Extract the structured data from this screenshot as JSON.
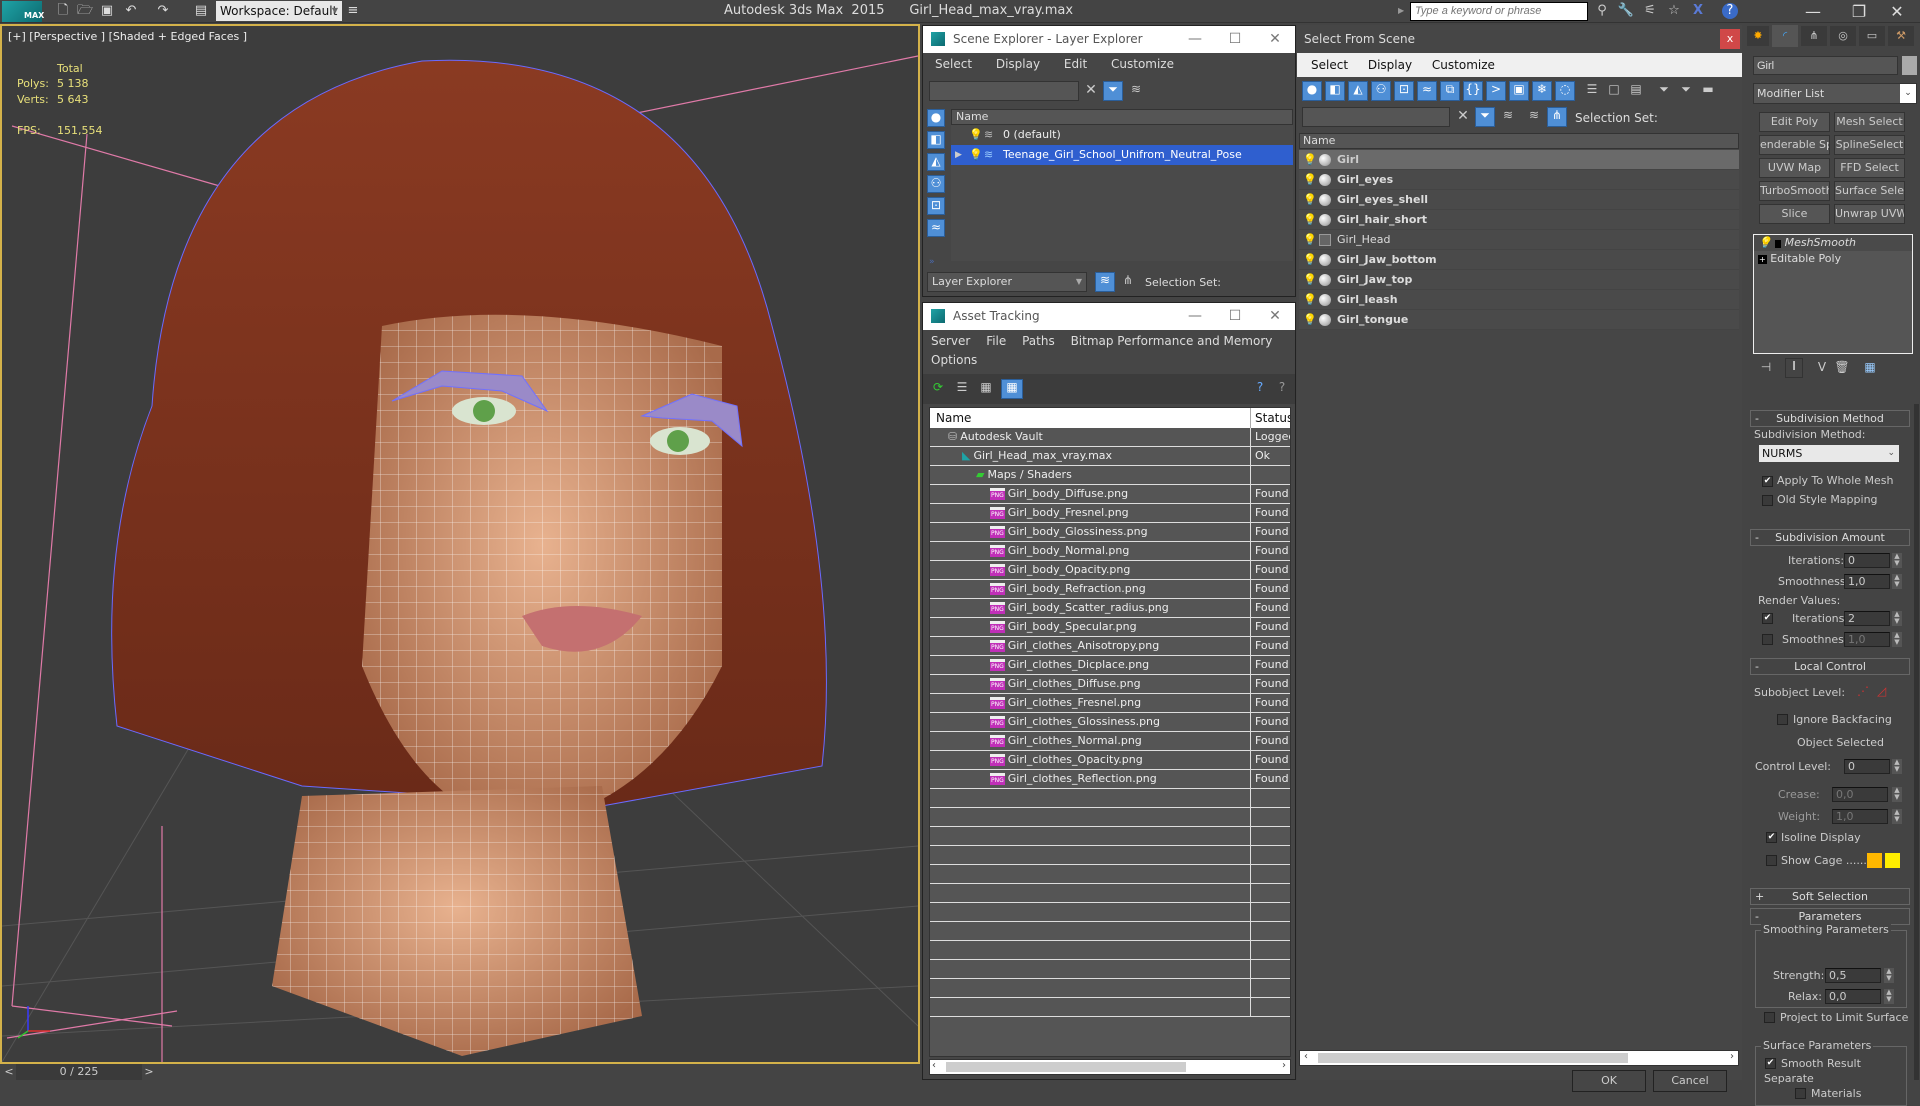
{
  "app": {
    "title": "Autodesk 3ds Max  2015      Girl_Head_max_vray.max",
    "logo_label": "MAX",
    "workspace": "Workspace: Default",
    "search_placeholder": "Type a keyword or phrase"
  },
  "viewport": {
    "label": "[+] [Perspective ] [Shaded + Edged Faces ]",
    "stats": {
      "total_label": "Total",
      "polys_label": "Polys:",
      "polys_value": "5 138",
      "verts_label": "Verts:",
      "verts_value": "5 643",
      "fps_label": "FPS:",
      "fps_value": "151,554"
    },
    "time_slider": "0 / 225",
    "prev_label": "<",
    "next_label": ">"
  },
  "scene_explorer": {
    "title": "Scene Explorer - Layer Explorer",
    "menu": [
      "Select",
      "Display",
      "Edit",
      "Customize"
    ],
    "column_name": "Name",
    "layers": [
      {
        "name": "0 (default)",
        "selected": false
      },
      {
        "name": "Teenage_Girl_School_Unifrom_Neutral_Pose",
        "selected": true
      }
    ],
    "mode": "Layer Explorer",
    "selection_set_label": "Selection Set:"
  },
  "asset_tracking": {
    "title": "Asset Tracking",
    "menu": [
      "Server",
      "File",
      "Paths",
      "Bitmap Performance and Memory",
      "Options"
    ],
    "columns": [
      "Name",
      "Status"
    ],
    "rows": [
      {
        "name": "Autodesk Vault",
        "status": "Logged",
        "level": 1,
        "icon": "vault-icon"
      },
      {
        "name": "Girl_Head_max_vray.max",
        "status": "Ok",
        "level": 2,
        "icon": "max-file-icon"
      },
      {
        "name": "Maps / Shaders",
        "status": "",
        "level": 3,
        "icon": "maps-icon"
      },
      {
        "name": "Girl_body_Diffuse.png",
        "status": "Found",
        "level": 4,
        "icon": "png-icon"
      },
      {
        "name": "Girl_body_Fresnel.png",
        "status": "Found",
        "level": 4,
        "icon": "png-icon"
      },
      {
        "name": "Girl_body_Glossiness.png",
        "status": "Found",
        "level": 4,
        "icon": "png-icon"
      },
      {
        "name": "Girl_body_Normal.png",
        "status": "Found",
        "level": 4,
        "icon": "png-icon"
      },
      {
        "name": "Girl_body_Opacity.png",
        "status": "Found",
        "level": 4,
        "icon": "png-icon"
      },
      {
        "name": "Girl_body_Refraction.png",
        "status": "Found",
        "level": 4,
        "icon": "png-icon"
      },
      {
        "name": "Girl_body_Scatter_radius.png",
        "status": "Found",
        "level": 4,
        "icon": "png-icon"
      },
      {
        "name": "Girl_body_Specular.png",
        "status": "Found",
        "level": 4,
        "icon": "png-icon"
      },
      {
        "name": "Girl_clothes_Anisotropy.png",
        "status": "Found",
        "level": 4,
        "icon": "png-icon"
      },
      {
        "name": "Girl_clothes_Dicplace.png",
        "status": "Found",
        "level": 4,
        "icon": "png-icon"
      },
      {
        "name": "Girl_clothes_Diffuse.png",
        "status": "Found",
        "level": 4,
        "icon": "png-icon"
      },
      {
        "name": "Girl_clothes_Fresnel.png",
        "status": "Found",
        "level": 4,
        "icon": "png-icon"
      },
      {
        "name": "Girl_clothes_Glossiness.png",
        "status": "Found",
        "level": 4,
        "icon": "png-icon"
      },
      {
        "name": "Girl_clothes_Normal.png",
        "status": "Found",
        "level": 4,
        "icon": "png-icon"
      },
      {
        "name": "Girl_clothes_Opacity.png",
        "status": "Found",
        "level": 4,
        "icon": "png-icon"
      },
      {
        "name": "Girl_clothes_Reflection.png",
        "status": "Found",
        "level": 4,
        "icon": "png-icon"
      }
    ],
    "png_badge": "PNG"
  },
  "select_from_scene": {
    "title": "Select From Scene",
    "close_label": "x",
    "menu": [
      "Select",
      "Display",
      "Customize"
    ],
    "selection_set_label": "Selection Set:",
    "column_name": "Name",
    "objects": [
      {
        "name": "Girl",
        "selected": true,
        "bold": true
      },
      {
        "name": "Girl_eyes",
        "selected": false,
        "bold": true
      },
      {
        "name": "Girl_eyes_shell",
        "selected": false,
        "bold": true
      },
      {
        "name": "Girl_hair_short",
        "selected": false,
        "bold": true
      },
      {
        "name": "Girl_Head",
        "selected": false,
        "bold": false
      },
      {
        "name": "Girl_Jaw_bottom",
        "selected": false,
        "bold": true
      },
      {
        "name": "Girl_Jaw_top",
        "selected": false,
        "bold": true
      },
      {
        "name": "Girl_leash",
        "selected": false,
        "bold": true
      },
      {
        "name": "Girl_tongue",
        "selected": false,
        "bold": true
      }
    ],
    "ok_label": "OK",
    "cancel_label": "Cancel"
  },
  "command_panel": {
    "object_name": "Girl",
    "modifier_list": "Modifier List",
    "modifier_buttons": [
      "Edit Poly",
      "Mesh Select",
      "enderable Splin",
      "SplineSelect",
      "UVW Map",
      "FFD Select",
      "TurboSmooth",
      "Surface Select",
      "Slice",
      "Unwrap UVW"
    ],
    "stack": [
      "MeshSmooth",
      "Editable Poly"
    ],
    "subdivision_method": {
      "header": "Subdivision Method",
      "label": "Subdivision Method:",
      "value": "NURMS",
      "apply_whole_mesh": {
        "label": "Apply To Whole Mesh",
        "checked": true
      },
      "old_style_mapping": {
        "label": "Old Style Mapping",
        "checked": false
      }
    },
    "subdivision_amount": {
      "header": "Subdivision Amount",
      "iterations_label": "Iterations:",
      "iterations": "0",
      "smoothness_label": "Smoothness:",
      "smoothness": "1,0",
      "render_values_label": "Render Values:",
      "render_iterations_checked": true,
      "render_iterations": "2",
      "render_smoothness_checked": false,
      "render_smoothness": "1,0"
    },
    "local_control": {
      "header": "Local Control",
      "subobject_label": "Subobject Level:",
      "ignore_backfacing": {
        "label": "Ignore Backfacing",
        "checked": false
      },
      "status": "Object Selected",
      "control_level_label": "Control Level:",
      "control_level": "0",
      "crease_label": "Crease:",
      "crease": "0,0",
      "weight_label": "Weight:",
      "weight": "1,0",
      "isoline_display": {
        "label": "Isoline Display",
        "checked": true
      },
      "show_cage": {
        "label": "Show Cage ......",
        "checked": false
      },
      "cage_colors": [
        "#ffb800",
        "#ffee00"
      ]
    },
    "soft_selection": {
      "header": "Soft Selection"
    },
    "parameters": {
      "header": "Parameters",
      "smoothing_group": "Smoothing Parameters",
      "strength_label": "Strength:",
      "strength": "0,5",
      "relax_label": "Relax:",
      "relax": "0,0",
      "project_limit": {
        "label": "Project to Limit Surface",
        "checked": false
      },
      "surface_group": "Surface Parameters",
      "smooth_result": {
        "label": "Smooth Result",
        "checked": true
      },
      "separate_label": "Separate",
      "materials": {
        "label": "Materials",
        "checked": false
      }
    }
  }
}
